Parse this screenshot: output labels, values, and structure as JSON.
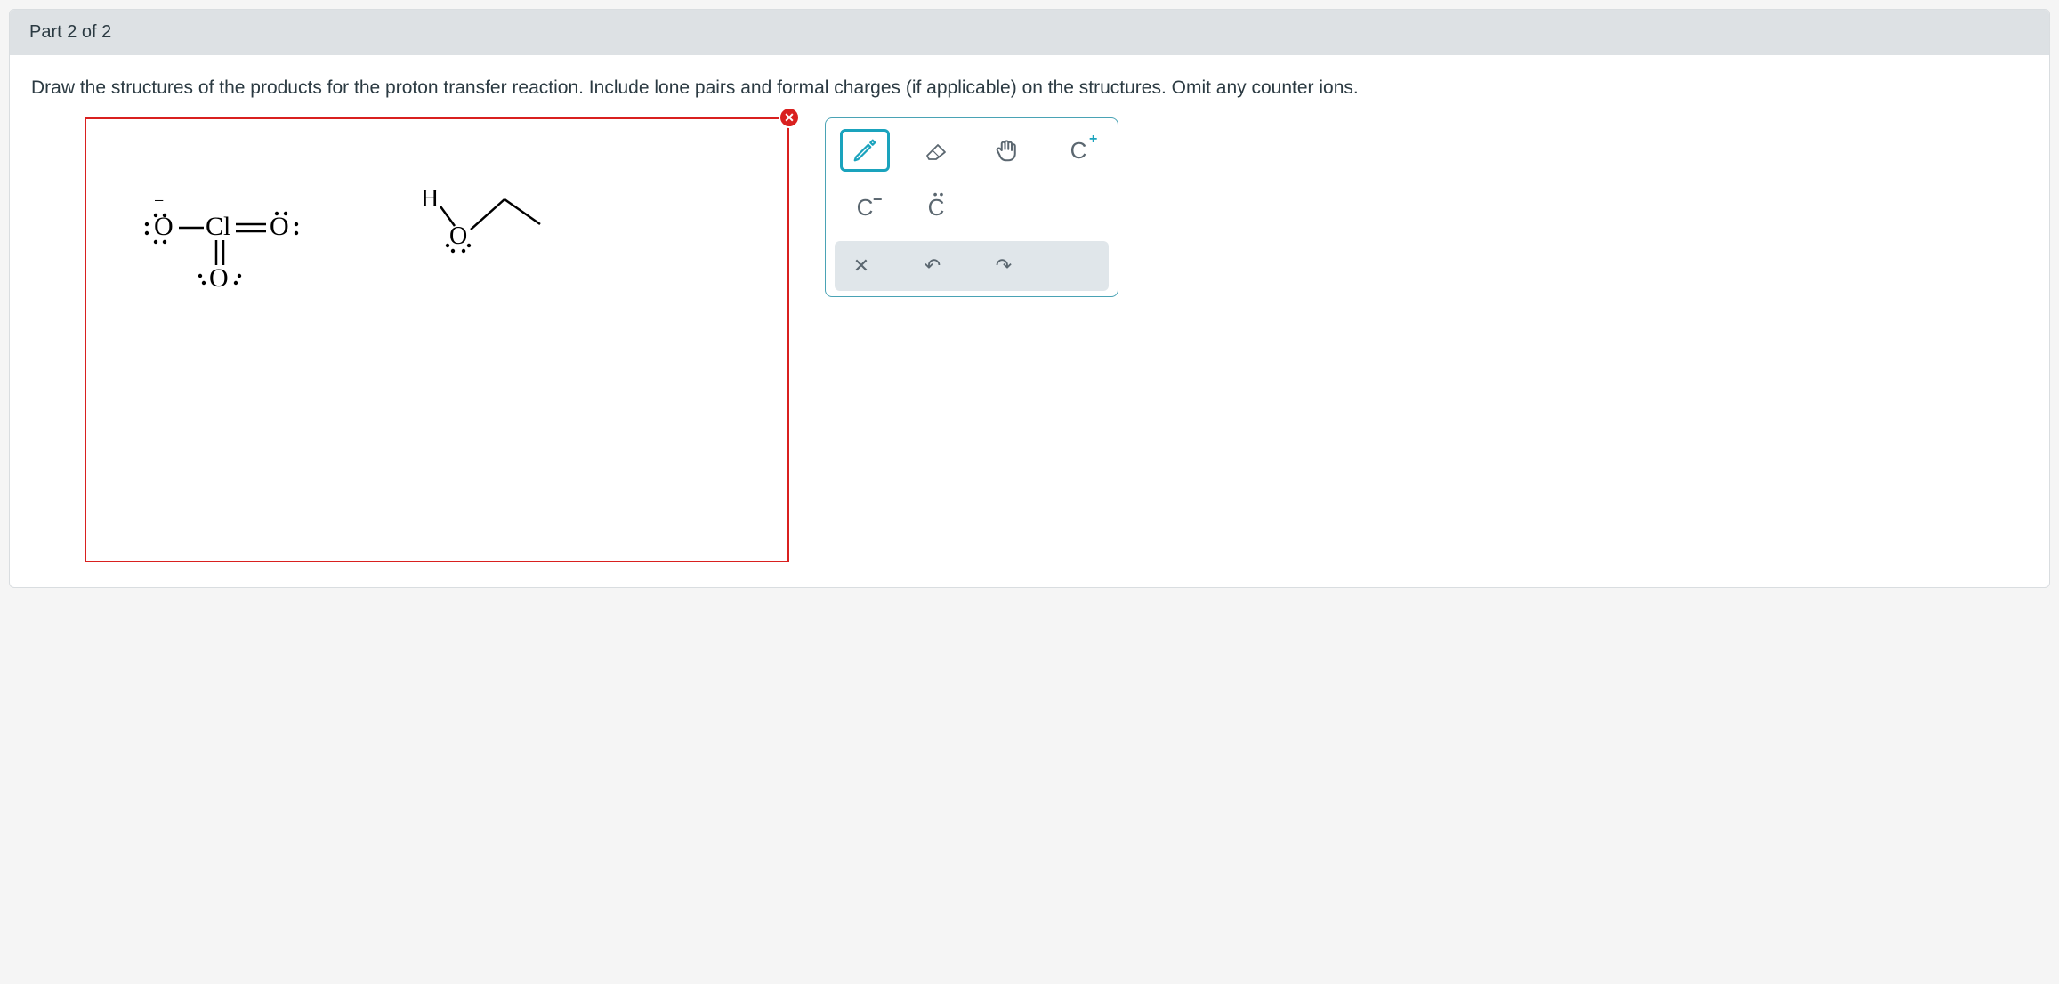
{
  "header": {
    "part_label": "Part 2 of 2"
  },
  "prompt": "Draw the structures of the products for the proton transfer reaction. Include lone pairs and formal charges (if applicable) on the structures. Omit any counter ions.",
  "canvas": {
    "error_badge": "✕",
    "structures": {
      "chlorate": {
        "left_o_charge": "−",
        "left_o": "O",
        "cl": "Cl",
        "right_o": "O",
        "bottom_o": "O"
      },
      "ether": {
        "h": "H",
        "o": "O"
      }
    }
  },
  "toolbox": {
    "row1": {
      "draw": "draw-tool",
      "erase": "erase-tool",
      "move": "move-tool",
      "charge_plus": "C",
      "charge_plus_sup": "+"
    },
    "row2": {
      "charge_minus": "C",
      "charge_minus_sup": "−",
      "lone_pair": "C",
      "lone_pair_dots": "••"
    },
    "actions": {
      "clear": "✕",
      "undo": "↶",
      "redo": "↷"
    }
  }
}
